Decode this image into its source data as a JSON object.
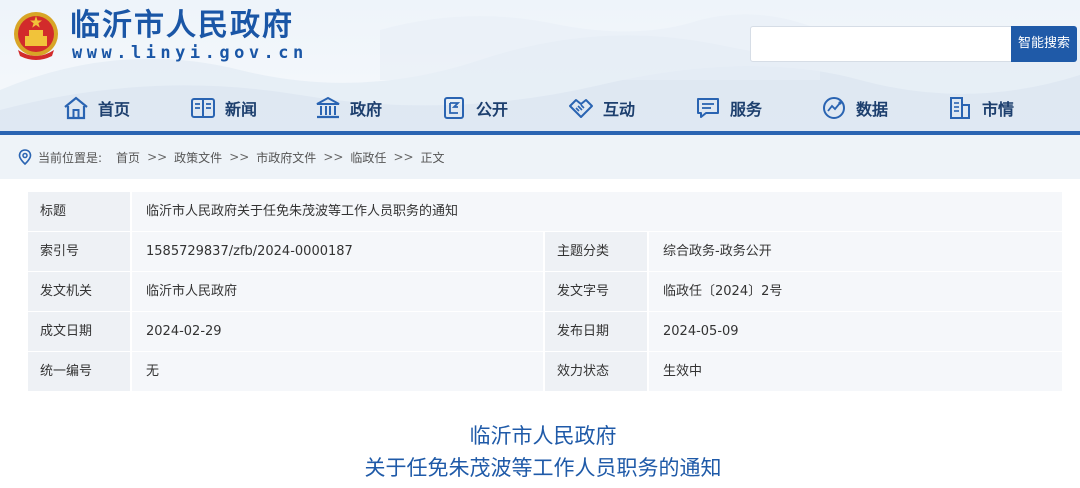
{
  "header": {
    "site_title": "临沂市人民政府",
    "site_url": "www.linyi.gov.cn",
    "search_placeholder": "",
    "search_button": "智能搜索"
  },
  "nav": {
    "items": [
      {
        "label": "首页",
        "icon": "home-icon"
      },
      {
        "label": "新闻",
        "icon": "newspaper-icon"
      },
      {
        "label": "政府",
        "icon": "government-building-icon"
      },
      {
        "label": "公开",
        "icon": "public-notice-icon"
      },
      {
        "label": "互动",
        "icon": "handshake-icon"
      },
      {
        "label": "服务",
        "icon": "service-chat-icon"
      },
      {
        "label": "数据",
        "icon": "data-globe-icon"
      },
      {
        "label": "市情",
        "icon": "city-building-icon"
      }
    ]
  },
  "breadcrumb": {
    "label": "当前位置是:",
    "items": [
      "首页",
      "政策文件",
      "市政府文件",
      "临政任",
      "正文"
    ],
    "separator": ">>"
  },
  "info": {
    "title_key": "标题",
    "title_value": "临沂市人民政府关于任免朱茂波等工作人员职务的通知",
    "rows": [
      {
        "k1": "索引号",
        "v1": "1585729837/zfb/2024-0000187",
        "k2": "主题分类",
        "v2": "综合政务-政务公开"
      },
      {
        "k1": "发文机关",
        "v1": "临沂市人民政府",
        "k2": "发文字号",
        "v2": "临政任〔2024〕2号"
      },
      {
        "k1": "成文日期",
        "v1": "2024-02-29",
        "k2": "发布日期",
        "v2": "2024-05-09"
      },
      {
        "k1": "统一编号",
        "v1": "无",
        "k2": "效力状态",
        "v2": "生效中"
      }
    ]
  },
  "document": {
    "heading_line1": "临沂市人民政府",
    "heading_line2": "关于任免朱茂波等工作人员职务的通知"
  },
  "colors": {
    "brand_blue": "#1f5aa8",
    "nav_text": "#1d3f6e",
    "table_key_bg": "#eef1f5",
    "table_value_bg": "#f5f7fa"
  }
}
